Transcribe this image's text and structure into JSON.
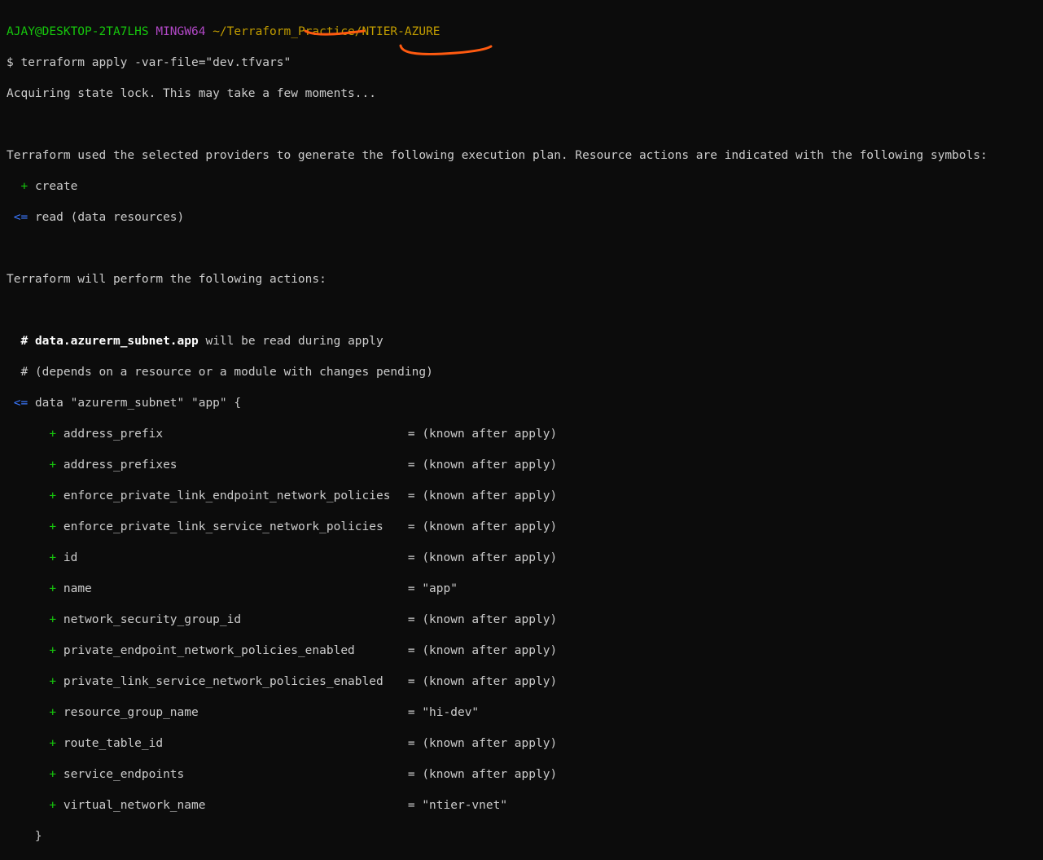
{
  "colors": {
    "background": "#0c0c0c",
    "text": "#cccccc",
    "prompt_user": "#16c60c",
    "prompt_shell": "#b148c6",
    "prompt_path": "#c19c00",
    "plan_add": "#16c60c",
    "plan_read": "#3b78ff",
    "annotation_marker": "#ff5a10"
  },
  "prompt": {
    "user_host": "AJAY@DESKTOP-2TA7LHS",
    "shell": "MINGW64",
    "path": "~/Terraform_Practice/NTIER-AZURE"
  },
  "command": "$ terraform apply -var-file=\"dev.tfvars\"",
  "lock_message": "Acquiring state lock. This may take a few moments...",
  "plan_intro": "Terraform used the selected providers to generate the following execution plan. Resource actions are indicated with the following symbols:",
  "symbols": [
    {
      "symbol": "+",
      "label": "create"
    },
    {
      "symbol": "<=",
      "label": "read (data resources)"
    }
  ],
  "actions_intro": "Terraform will perform the following actions:",
  "data_block": {
    "comment_hash": "#",
    "resource_address": "data.azurerm_subnet.app",
    "comment_suffix": "will be read during apply",
    "depends_note": "# (depends on a resource or a module with changes pending)",
    "read_symbol": "<=",
    "declaration": "data \"azurerm_subnet\" \"app\" {",
    "attr_symbol": "+",
    "attributes": [
      {
        "name": "address_prefix",
        "value": "= (known after apply)"
      },
      {
        "name": "address_prefixes",
        "value": "= (known after apply)"
      },
      {
        "name": "enforce_private_link_endpoint_network_policies",
        "value": "= (known after apply)"
      },
      {
        "name": "enforce_private_link_service_network_policies",
        "value": "= (known after apply)"
      },
      {
        "name": "id",
        "value": "= (known after apply)"
      },
      {
        "name": "name",
        "value": "= \"app\""
      },
      {
        "name": "network_security_group_id",
        "value": "= (known after apply)"
      },
      {
        "name": "private_endpoint_network_policies_enabled",
        "value": "= (known after apply)"
      },
      {
        "name": "private_link_service_network_policies_enabled",
        "value": "= (known after apply)"
      },
      {
        "name": "resource_group_name",
        "value": "= \"hi-dev\""
      },
      {
        "name": "route_table_id",
        "value": "= (known after apply)"
      },
      {
        "name": "service_endpoints",
        "value": "= (known after apply)"
      },
      {
        "name": "virtual_network_name",
        "value": "= \"ntier-vnet\""
      }
    ],
    "closing": "}"
  }
}
